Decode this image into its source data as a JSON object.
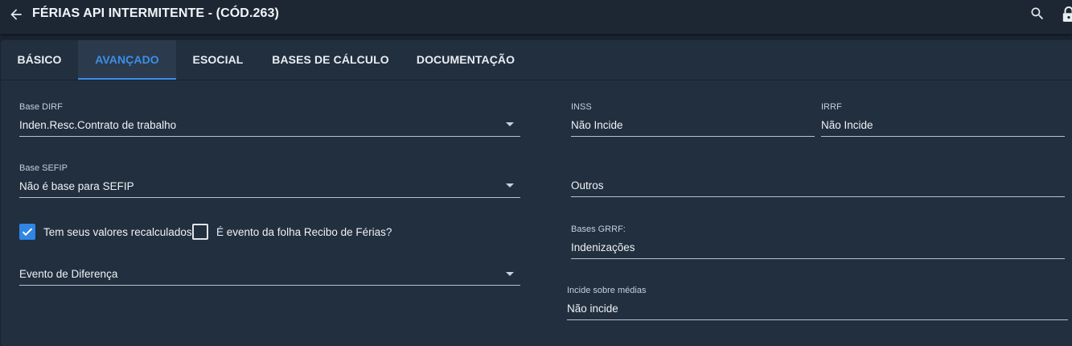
{
  "header": {
    "title": "FÉRIAS API INTERMITENTE - (CÓD.263)",
    "back_icon": "arrow-left-icon",
    "search_icon": "search-icon",
    "lock_icon": "lock-icon"
  },
  "tabs": [
    {
      "label": "BÁSICO",
      "active": false
    },
    {
      "label": "AVANÇADO",
      "active": true
    },
    {
      "label": "ESOCIAL",
      "active": false
    },
    {
      "label": "BASES DE CÁLCULO",
      "active": false
    },
    {
      "label": "DOCUMENTAÇÃO",
      "active": false
    }
  ],
  "form": {
    "base_dirf": {
      "label": "Base DIRF",
      "value": "Inden.Resc.Contrato de trabalho"
    },
    "base_sefip": {
      "label": "Base SEFIP",
      "value": "Não é base para SEFIP"
    },
    "recalculados": {
      "label": "Tem seus valores recalculados",
      "checked": true
    },
    "recibo_ferias": {
      "label": "É evento da folha Recibo de Férias?",
      "checked": false
    },
    "evento_diferenca": {
      "value": "Evento de Diferença"
    },
    "inss": {
      "label": "INSS",
      "value": "Não Incide"
    },
    "irrf": {
      "label": "IRRF",
      "value": "Não Incide"
    },
    "outros": {
      "value": "Outros"
    },
    "bases_grrf": {
      "label": "Bases GRRF:",
      "value": "Indenizações"
    },
    "incide_medias": {
      "label": "Incide sobre médias",
      "value": "Não incide"
    }
  },
  "colors": {
    "accent": "#3d8ee6",
    "background": "#1b2532",
    "panel": "#222f3f"
  }
}
